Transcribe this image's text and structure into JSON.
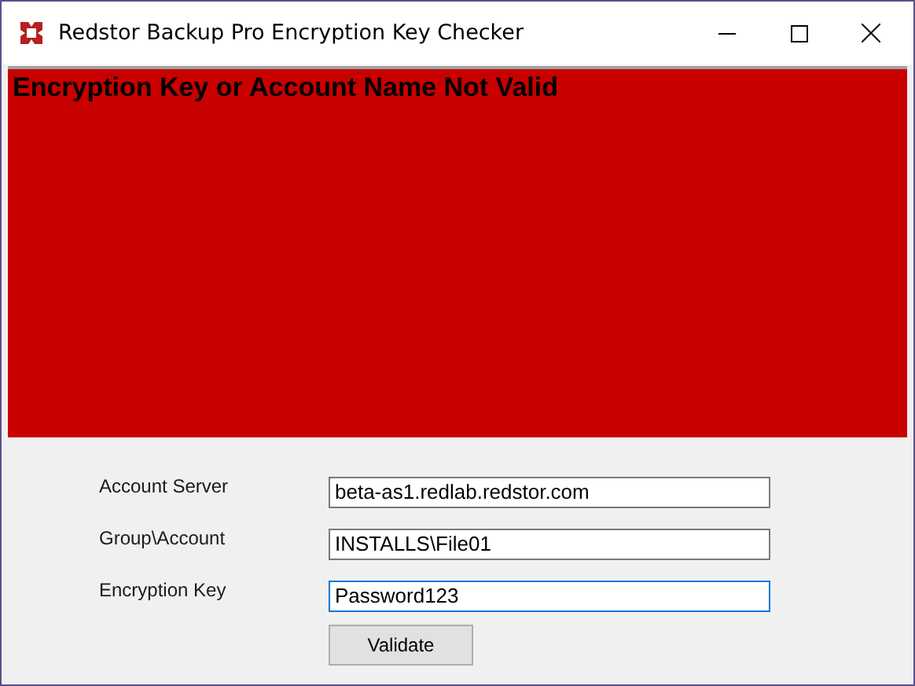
{
  "window": {
    "title": "Redstor Backup Pro Encryption Key Checker"
  },
  "status_panel": {
    "message": "Encryption Key or Account Name Not Valid"
  },
  "fields": [
    {
      "label": "Account Server",
      "value": "beta-as1.redlab.redstor.com",
      "focused": false
    },
    {
      "label": "Group\\Account",
      "value": "INSTALLS\\File01",
      "focused": false
    },
    {
      "label": "Encryption Key",
      "value": "Password123",
      "focused": true
    }
  ],
  "buttons": [
    "Validate"
  ]
}
